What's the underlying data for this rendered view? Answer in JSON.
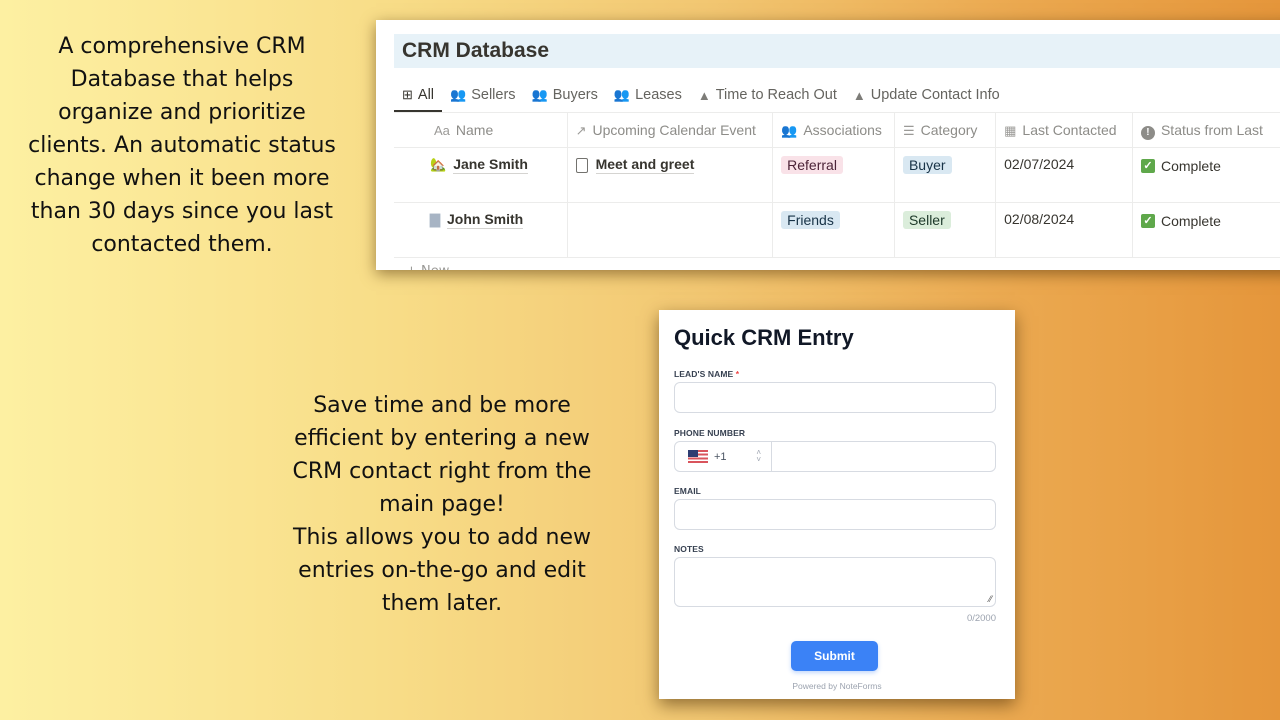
{
  "promo": {
    "database_text": "A comprehensive CRM\nDatabase that helps\norganize and prioritize\nclients. An automatic status\nchange when it been more\nthan 30 days since you last\ncontacted them.",
    "form_text": "Save time and be more\nefficient by entering a new\nCRM contact right from the\nmain page!\nThis allows you to add new\nentries on-the-go and edit\nthem later."
  },
  "database": {
    "title": "CRM Database",
    "tabs": [
      {
        "label": "All",
        "icon": "table-icon",
        "active": true
      },
      {
        "label": "Sellers",
        "icon": "people-icon",
        "active": false
      },
      {
        "label": "Buyers",
        "icon": "people-icon",
        "active": false
      },
      {
        "label": "Leases",
        "icon": "people-icon",
        "active": false
      },
      {
        "label": "Time to Reach Out",
        "icon": "warning-icon",
        "active": false
      },
      {
        "label": "Update Contact Info",
        "icon": "warning-icon",
        "active": false
      }
    ],
    "columns": [
      {
        "label": "Name",
        "icon_text": "Aa"
      },
      {
        "label": "Upcoming Calendar Event",
        "icon_text": "↗"
      },
      {
        "label": "Associations",
        "icon_text": "👥"
      },
      {
        "label": "Category",
        "icon_text": "☰"
      },
      {
        "label": "Last Contacted",
        "icon_text": "▦"
      },
      {
        "label": "Status from Last",
        "icon_text": "!"
      }
    ],
    "rows": [
      {
        "name": "Jane Smith",
        "name_icon": "house-icon",
        "event": "Meet and greet",
        "association": "Referral",
        "association_color": "#f9e2e8",
        "category": "Buyer",
        "category_color": "#d9e8f2",
        "last_contacted": "02/07/2024",
        "status": "Complete"
      },
      {
        "name": "John Smith",
        "name_icon": "page-icon",
        "event": "",
        "association": "Friends",
        "association_color": "#d9e8f2",
        "category": "Seller",
        "category_color": "#dbeddb",
        "last_contacted": "02/08/2024",
        "status": "Complete"
      }
    ],
    "new_row_label": "+ New"
  },
  "form": {
    "title": "Quick CRM Entry",
    "fields": {
      "lead_name": {
        "label": "LEAD'S NAME",
        "required_marker": "*",
        "value": ""
      },
      "phone": {
        "label": "PHONE NUMBER",
        "country_code": "+1",
        "country": "US",
        "value": ""
      },
      "email": {
        "label": "EMAIL",
        "value": ""
      },
      "notes": {
        "label": "NOTES",
        "value": "",
        "char_count": "0/2000"
      }
    },
    "submit_label": "Submit",
    "powered_by": "Powered by NoteForms",
    "accent_color": "#3b82f6"
  }
}
